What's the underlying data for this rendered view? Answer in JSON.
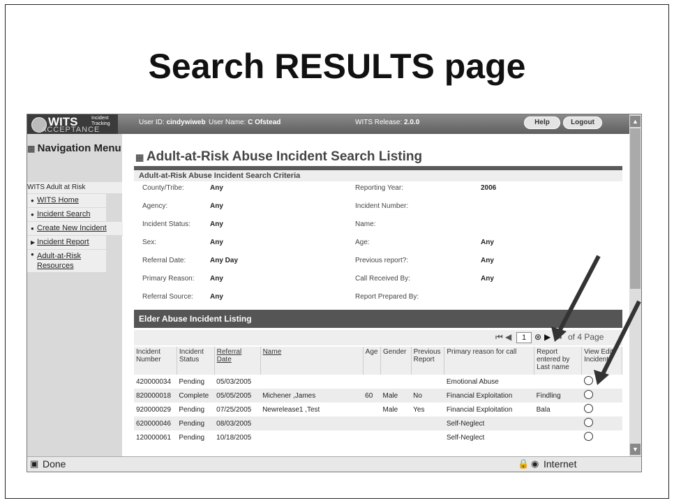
{
  "slide_title": "Search RESULTS page",
  "app": {
    "logo_text": "WITS",
    "logo_small_1": "Incident",
    "logo_small_2": "Tracking",
    "env": "ACCEPTANCE",
    "user_id_label": "User ID:",
    "user_id": "cindywiweb",
    "user_name_label": "User Name:",
    "user_name": "C Ofstead",
    "release_label": "WITS Release:",
    "release": "2.0.0",
    "help_label": "Help",
    "logout_label": "Logout"
  },
  "nav": {
    "title": "Navigation Menu",
    "section": "WITS Adult at Risk",
    "items": [
      "WITS Home",
      "Incident Search",
      "Create New Incident",
      "Incident Report",
      "Adult-at-Risk Resources"
    ]
  },
  "page_heading": "Adult-at-Risk Abuse Incident Search Listing",
  "criteria": {
    "title": "Adult-at-Risk Abuse Incident Search Criteria",
    "county_label": "County/Tribe:",
    "county": "Any",
    "agency_label": "Agency:",
    "agency": "Any",
    "status_label": "Incident Status:",
    "status": "Any",
    "sex_label": "Sex:",
    "sex": "Any",
    "referral_date_label": "Referral Date:",
    "referral_date": "Any Day",
    "primary_reason_label": "Primary Reason:",
    "primary_reason": "Any",
    "referral_source_label": "Referral Source:",
    "referral_source": "Any",
    "reporting_year_label": "Reporting Year:",
    "reporting_year": "2006",
    "incident_number_label": "Incident Number:",
    "name_label": "Name:",
    "age_label": "Age:",
    "age": "Any",
    "previous_report_label": "Previous report?:",
    "previous_report": "Any",
    "call_received_label": "Call Received By:",
    "call_received": "Any",
    "report_prepared_label": "Report Prepared By:"
  },
  "listing": {
    "title": "Elder Abuse Incident Listing",
    "page": "1",
    "of_pages": "of 4  Page",
    "columns": [
      "Incident Number",
      "Incident Status",
      "Referral Date",
      "Name",
      "Age",
      "Gender",
      "Previous Report",
      "Primary reason for call",
      "Report entered by Last name",
      "View Edit Incident"
    ],
    "rows": [
      [
        "420000034",
        "Pending",
        "05/03/2005",
        "",
        "",
        "",
        "",
        "Emotional Abuse",
        ""
      ],
      [
        "820000018",
        "Complete",
        "05/05/2005",
        "Michener ,James",
        "60",
        "Male",
        "No",
        "Financial Exploitation",
        "Findling"
      ],
      [
        "920000029",
        "Pending",
        "07/25/2005",
        "Newrelease1 ,Test",
        "",
        "Male",
        "Yes",
        "Financial Exploitation",
        "Bala"
      ],
      [
        "620000046",
        "Pending",
        "08/03/2005",
        "",
        "",
        "",
        "",
        "Self-Neglect",
        ""
      ],
      [
        "120000061",
        "Pending",
        "10/18/2005",
        "",
        "",
        "",
        "",
        "Self-Neglect",
        ""
      ]
    ]
  },
  "statusbar": {
    "done": "Done",
    "zone": "Internet"
  }
}
